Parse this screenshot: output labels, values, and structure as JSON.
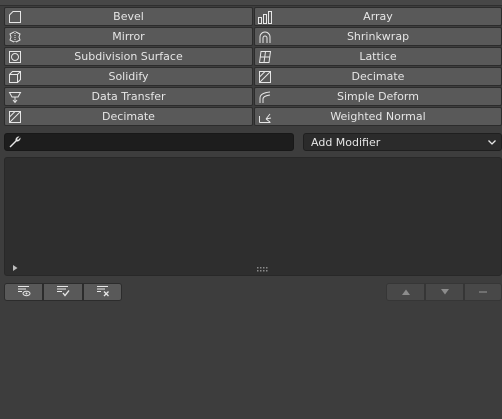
{
  "modifiers": {
    "left": [
      "Bevel",
      "Mirror",
      "Subdivision Surface",
      "Solidify",
      "Data Transfer",
      "Decimate"
    ],
    "right": [
      "Array",
      "Shrinkwrap",
      "Lattice",
      "Decimate",
      "Simple Deform",
      "Weighted Normal"
    ]
  },
  "name_field": {
    "value": ""
  },
  "add_modifier": {
    "label": "Add Modifier"
  },
  "icons": {
    "left": [
      "bevel-icon",
      "mirror-icon",
      "subdivision-icon",
      "solidify-icon",
      "data-transfer-icon",
      "decimate-icon"
    ],
    "right": [
      "array-icon",
      "shrinkwrap-icon",
      "lattice-icon",
      "decimate-icon",
      "simple-deform-icon",
      "weighted-normal-icon"
    ],
    "name_field": "wrench-icon",
    "list_tools": [
      "filter-visibility-icon",
      "select-all-icon",
      "deselect-all-icon"
    ],
    "list_nav": [
      "move-up-icon",
      "move-down-icon",
      "remove-icon"
    ]
  },
  "colors": {
    "background": "#3d3d3d",
    "button": "#595959",
    "field": "#1d1d1d",
    "dropdown": "#2b2b2b",
    "panel": "#2e2e2e",
    "text": "#e6e6e6"
  }
}
